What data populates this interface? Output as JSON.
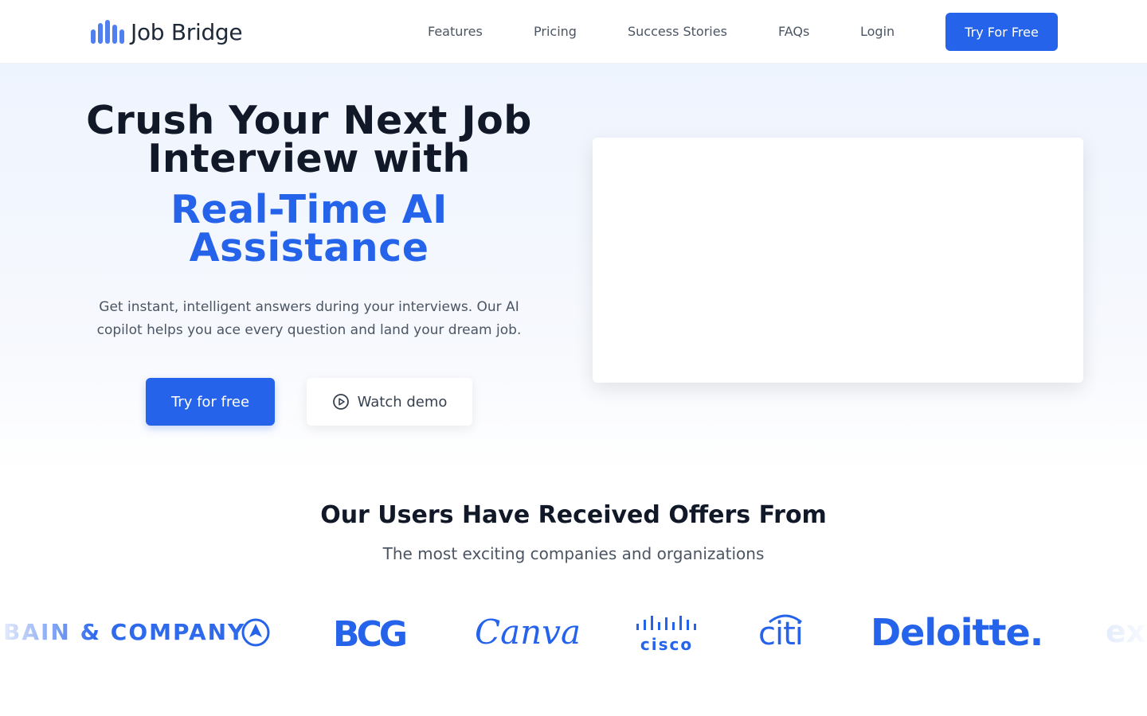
{
  "header": {
    "brand": "Job Bridge",
    "nav": [
      "Features",
      "Pricing",
      "Success Stories",
      "FAQs",
      "Login"
    ],
    "cta": "Try For Free"
  },
  "hero": {
    "title": "Crush Your Next Job Interview with",
    "accent": "Real-Time AI Assistance",
    "description": "Get instant, intelligent answers during your interviews. Our AI copilot helps you ace every question and land your dream job.",
    "primary_button": "Try for free",
    "secondary_button": "Watch demo",
    "secondary_icon": "play-circle-icon"
  },
  "companies": {
    "title": "Our Users Have Received Offers From",
    "subtitle": "The most exciting companies and organizations",
    "logos": [
      "BAIN & COMPANY",
      "BCG",
      "Canva",
      "cisco",
      "citi",
      "Deloitte.",
      "ex"
    ]
  },
  "colors": {
    "accent": "#2563eb",
    "logo_bars": "#4f7ff0",
    "text_dark": "#111827",
    "text_muted": "#4b5563"
  }
}
